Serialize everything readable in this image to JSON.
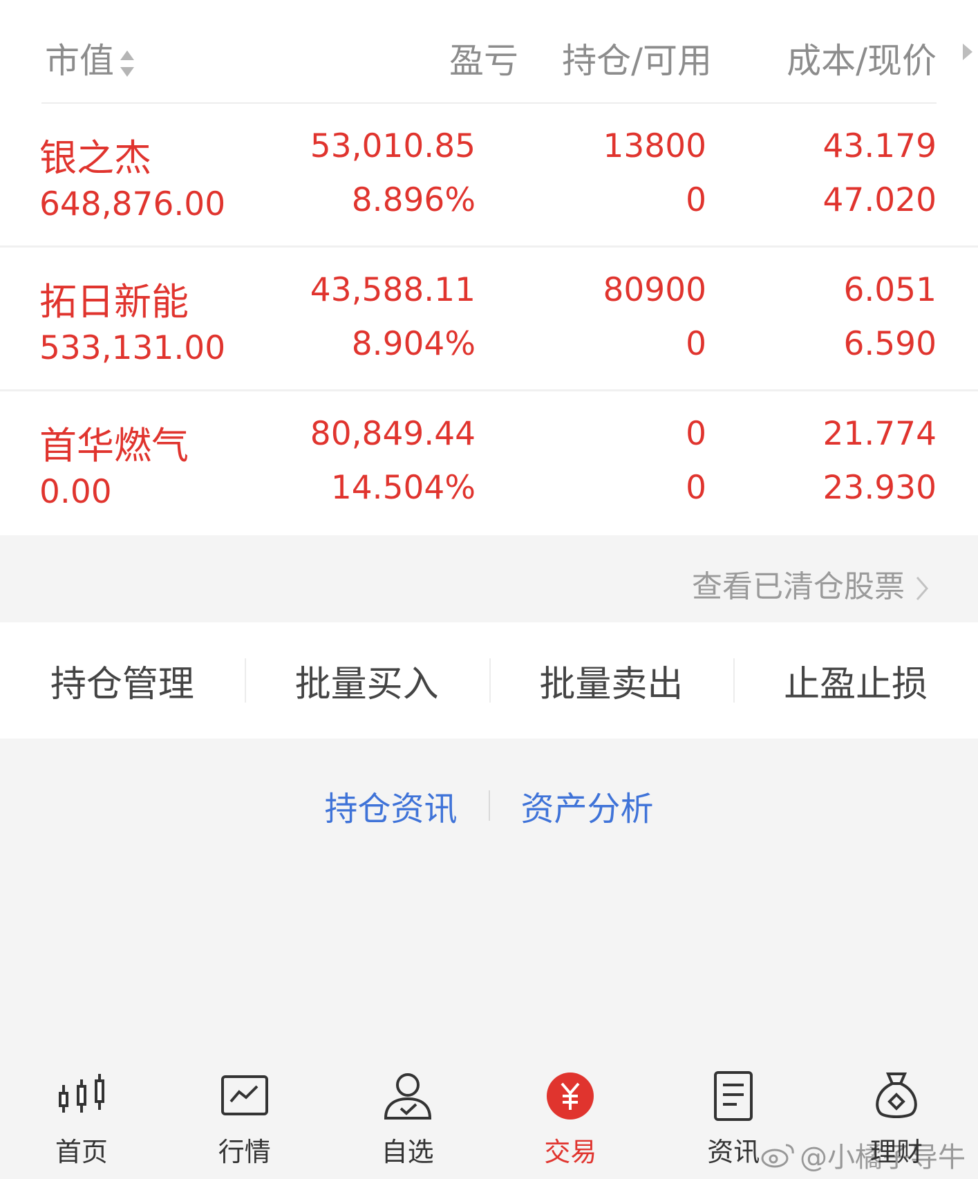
{
  "header": {
    "market_value": "市值",
    "pnl": "盈亏",
    "position": "持仓/可用",
    "cost_price": "成本/现价"
  },
  "holdings": [
    {
      "name": "银之杰",
      "market_value": "648,876.00",
      "pnl": "53,010.85",
      "pnl_ratio": "8.896%",
      "position": "13800",
      "available": "0",
      "cost": "43.179",
      "price": "47.020"
    },
    {
      "name": "拓日新能",
      "market_value": "533,131.00",
      "pnl": "43,588.11",
      "pnl_ratio": "8.904%",
      "position": "80900",
      "available": "0",
      "cost": "6.051",
      "price": "6.590"
    },
    {
      "name": "首华燃气",
      "market_value": "0.00",
      "pnl": "80,849.44",
      "pnl_ratio": "14.504%",
      "position": "0",
      "available": "0",
      "cost": "21.774",
      "price": "23.930"
    }
  ],
  "cleared_link": "查看已清仓股票",
  "actions": [
    "持仓管理",
    "批量买入",
    "批量卖出",
    "止盈止损"
  ],
  "links": [
    "持仓资讯",
    "资产分析"
  ],
  "tabs": [
    {
      "label": "首页",
      "icon": "candlestick-icon"
    },
    {
      "label": "行情",
      "icon": "chart-icon"
    },
    {
      "label": "自选",
      "icon": "user-check-icon"
    },
    {
      "label": "交易",
      "icon": "yuan-icon"
    },
    {
      "label": "资讯",
      "icon": "document-icon"
    },
    {
      "label": "理财",
      "icon": "money-bag-icon"
    }
  ],
  "active_tab": "交易",
  "watermark": "@小橘子导牛",
  "colors": {
    "up_red": "#e0342e",
    "link_blue": "#3f73d8",
    "header_gray": "#8c8c8c"
  }
}
